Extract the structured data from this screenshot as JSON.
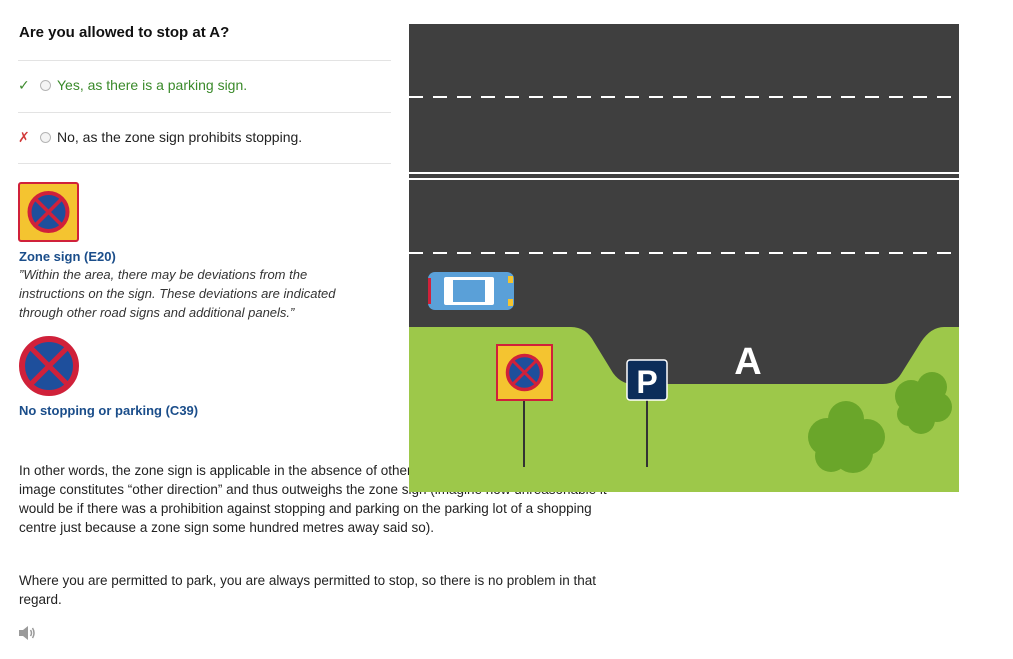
{
  "question": "Are you allowed to stop at A?",
  "options": [
    {
      "mark": "✓",
      "label": "Yes, as there is a parking sign.",
      "status": "correct"
    },
    {
      "mark": "✗",
      "label": "No, as the zone sign prohibits stopping.",
      "status": "wrong"
    }
  ],
  "signs": [
    {
      "icon": "zone-sign-e20-icon",
      "title": "Zone sign (E20)",
      "description": "”Within the area, there may be deviations from the instructions on the sign. These deviations are indicated through other road signs and additional panels.”"
    },
    {
      "icon": "no-stopping-sign-c39-icon",
      "title": "No stopping or parking (C39)"
    }
  ],
  "explanation": [
    "In other words, the zone sign is applicable in the absence of other directions. The parking sign in the image constitutes “other direction” and thus outweighs the zone sign (imagine how unreasonable it would be if there was a prohibition against stopping and parking on the parking lot of a shopping centre just because a zone sign some hundred metres away said so).",
    "Where you are permitted to park, you are always permitted to stop, so there is no problem in that regard."
  ],
  "scene": {
    "location_label": "A",
    "parking_sign_letter": "P"
  },
  "colors": {
    "road": "#3f3f3f",
    "grass": "#9dc84a",
    "sign_yellow": "#f4c430",
    "sign_red": "#d0213a",
    "sign_blue": "#1e4f9c",
    "parking_blue": "#0c2d5a",
    "correct_green": "#3a8a2a",
    "wrong_red": "#d23a3a",
    "title_blue": "#1a4d8a"
  },
  "audio": {
    "icon": "speaker-icon"
  }
}
